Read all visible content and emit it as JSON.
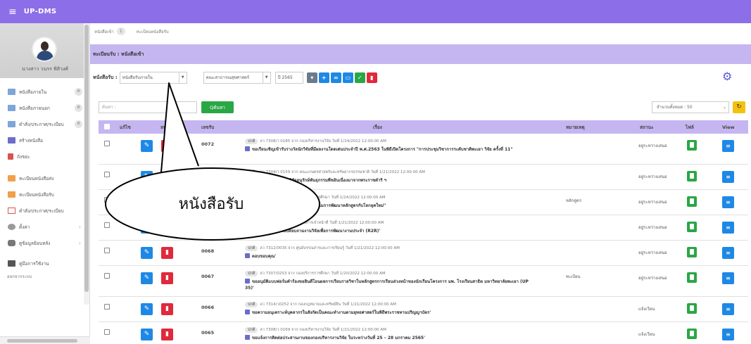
{
  "app": {
    "title": "UP-DMS"
  },
  "profile": {
    "name": "นางสาว วนรร พิสิวงศ์"
  },
  "sidebar": {
    "items": [
      {
        "label": "หนังสือภายใน",
        "count": "0",
        "icon": "mail-icon"
      },
      {
        "label": "หนังสือภายนอก",
        "count": "0",
        "icon": "mail-icon"
      },
      {
        "label": "คำสั่ง/ประกาศ/ระเบียบ",
        "count": "0",
        "icon": "mail-icon"
      },
      {
        "label": "สร้างหนังสือ",
        "icon": "document-icon"
      },
      {
        "label": "ถังขยะ",
        "icon": "trash-icon"
      },
      {
        "label": "ทะเบียนหนังสือส่ง",
        "icon": "outbox-icon"
      },
      {
        "label": "ทะเบียนหนังสือรับ",
        "icon": "outbox-icon"
      },
      {
        "label": "คำสั่ง/ประกาศ/ระเบียบ",
        "icon": "book-icon"
      },
      {
        "label": "ตั้งค่า",
        "icon": "gear-icon"
      },
      {
        "label": "ดูข้อมูลย้อนหลัง",
        "icon": "database-icon"
      },
      {
        "label": "คู่มือการใช้งาน",
        "icon": "manual-icon"
      }
    ],
    "logout": "ออกจากระบบ"
  },
  "breadcrumb": {
    "item1": "หนังสือเข้า",
    "item1_badge": "1",
    "item2": "ทะเบียนหนังสือรับ"
  },
  "page_title": "ทะเบียนรับ : หนังสือเข้า",
  "filter": {
    "label": "หนังสือรับ :",
    "type_value": "หนังสือรับภายใน",
    "dept_value": "คณะสาธารณสุขศาสตร์",
    "year_value": "ปี 2565"
  },
  "search": {
    "placeholder": "ค้นหา :",
    "button": "Qค้นหา",
    "count_label": "จำนวนทั้งหมด : 50"
  },
  "table": {
    "headers": {
      "read": "แก้ไข",
      "del": "ลบ",
      "no": "เลขรับ",
      "subject": "เรื่อง",
      "note": "หมายเหตุ",
      "status": "สถานะ",
      "file": "ไฟล์",
      "view": "View"
    },
    "rows": [
      {
        "no": "0072",
        "tag": "ปกติ",
        "meta": "ลว 7308/ว 0185 จาก กองบริหารงานวิจัย วันที่ 1/24/2022 12:00:00 AM",
        "title": "ขอเรียนเชิญเข้ารับรางวัลนักวิจัยที่มีผลงานโดดเด่นประจำปี พ.ศ.2563 ในพิธีเปิดโครงการ \"การประชุมวิชาการระดับชาติพะเยา วิจัย ครั้งที่ 11\"",
        "note": "",
        "status": "อยู่ระหว่างเสนอ"
      },
      {
        "no": "0071",
        "tag": "ปกติ",
        "meta": "ลว 7304/ว 0159 จาก คณะเกษตรศาสตร์และทรัพยากรธรรมชาติ วันที่ 1/21/2022 12:00:00 AM",
        "title": "ขอเชิญร่วมโครงการวิจัยอนุรักษ์พันธุกรรมพืชอันเนื่องมาจากพระราชดำริ ฯ",
        "note": "",
        "status": "อยู่ระหว่างเสนอ"
      },
      {
        "no": "0070",
        "tag": "ปกติ",
        "meta": "ลว 7307/0250 จาก กองบริการการศึกษา วันที่ 1/24/2022 12:00:00 AM",
        "title": "ขอเชิญร่วมการสัมมนาหัวข้อ \"แนวโน้มการพัฒนาหลักสูตรกับโลกยุคใหม่\"",
        "note": "หลักสูตร",
        "status": "อยู่ระหว่างเสนอ"
      },
      {
        "no": "0069",
        "tag": "ปกติ",
        "meta": "ลว 7301/ว 0176 จาก กองการเจ้าหน้าที่ วันที่ 1/21/2022 12:00:00 AM",
        "title": "ขอเชิญร่วมตอบแบบสอบถามงานวิจัยเพื่อการพัฒนางานประจำ (R2R)'",
        "note": "",
        "status": "อยู่ระหว่างเสนอ"
      },
      {
        "no": "0068",
        "tag": "ปกติ",
        "meta": "ลว 7312/0035 จาก ศูนย์บรรณสารและการเรียนรู้ วันที่ 1/21/2022 12:00:00 AM",
        "title": "ตอบขอบคุณ'",
        "note": "",
        "status": "อยู่ระหว่างเสนอ"
      },
      {
        "no": "0067",
        "tag": "ปกติ",
        "meta": "ลว 7307/0253 จาก กองบริการการศึกษา วันที่ 1/20/2022 12:00:00 AM",
        "title": "ขออนุมัติแบบฟอร์มคำร้องขอยินดีโอนผลการเรียนรายวิชาในหลักสูตรการเรียนล่วงหน้าของนักเรียนโครงการ มพ. โรงเรียนสาธิต มหาวิทยาลัยพะเยา (UP 35)'",
        "note": "ทะเบียน",
        "status": "อยู่ระหว่างเสนอ"
      },
      {
        "no": "0066",
        "tag": "ปกติ",
        "meta": "ลว 7314/ว0252 จาก กองกฎหมายและทรัพย์สิน วันที่ 1/21/2022 12:00:00 AM",
        "title": "ขอความอนุเคราะห์บุคลากรในสังกัดเป็นคณะทำงานตามยุทธศาสตร์ในพิธีพระราชทานปริญญาบัตร'",
        "note": "",
        "status": "แจ้งเวียน"
      },
      {
        "no": "0065",
        "tag": "ปกติ",
        "meta": "ลว 7308/ว 0169 จาก กองบริหารงานวิจัย วันที่ 1/21/2022 12:00:00 AM",
        "title": "ขอแจ้งการติดต่อประสานงานของกองบริหารงานวิจัย ในระหว่างวันที่ 25 – 28 มกราคม 2565'",
        "note": "",
        "status": "แจ้งเวียน"
      }
    ]
  },
  "callout": {
    "text": "หนังสือรับ"
  },
  "colors": {
    "topbar": "#8c6ee8",
    "band": "#c5b6f2",
    "green": "#2aa745",
    "red": "#e0293b",
    "blue": "#1e88e5"
  }
}
